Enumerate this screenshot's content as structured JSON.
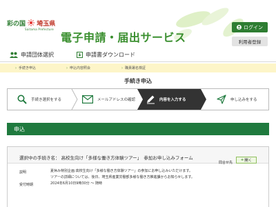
{
  "header": {
    "logo_main": "彩の国",
    "logo_pref": "埼玉県",
    "logo_sub": "Saitama Prefecture",
    "site_title": "電子申請・届出サービス",
    "login_label": "ログイン",
    "register_label": "利用者登録",
    "colors": {
      "brand_green": "#2e7d32",
      "title_green": "#3a8f2f"
    }
  },
  "nav": {
    "items": [
      {
        "label": "申請団体選択",
        "icon": "people-icon"
      },
      {
        "label": "申請書ダウンロード",
        "icon": "download-icon"
      }
    ]
  },
  "breadcrumb": {
    "items": [
      "手続き申込",
      "申込内容照会",
      "職責署名検証"
    ]
  },
  "steps": {
    "title": "手続き申込",
    "items": [
      {
        "label": "手続き選択をする",
        "icon": "search-icon",
        "active": false
      },
      {
        "label": "メールアドレスの確認",
        "icon": "mail-icon",
        "active": false
      },
      {
        "label": "内容を入力する",
        "icon": "pencil-icon",
        "active": true
      },
      {
        "label": "申し込みをする",
        "icon": "send-icon",
        "active": false
      }
    ],
    "active_color": "#333333"
  },
  "section": {
    "title": "申込"
  },
  "detail": {
    "procedure": "選択中の手続き名：  高校生向け「多様な働き方体験ツアー」　参加お申し込みフォーム",
    "contact_label": "問合せ先",
    "open_label": "開く",
    "rows": [
      {
        "label": "説明",
        "lines": [
          "夏休み特別企画:高校生向け「多様な働き方体験ツアー」の参加にお申し込みいただけます。",
          "ツアーの詳細については、後日、埼玉県産業労働部多様な働き方推進課からお知らせします。"
        ]
      },
      {
        "label": "受付時期",
        "lines": [
          "2024年6月10日9時30分 〜 随時"
        ]
      }
    ]
  }
}
